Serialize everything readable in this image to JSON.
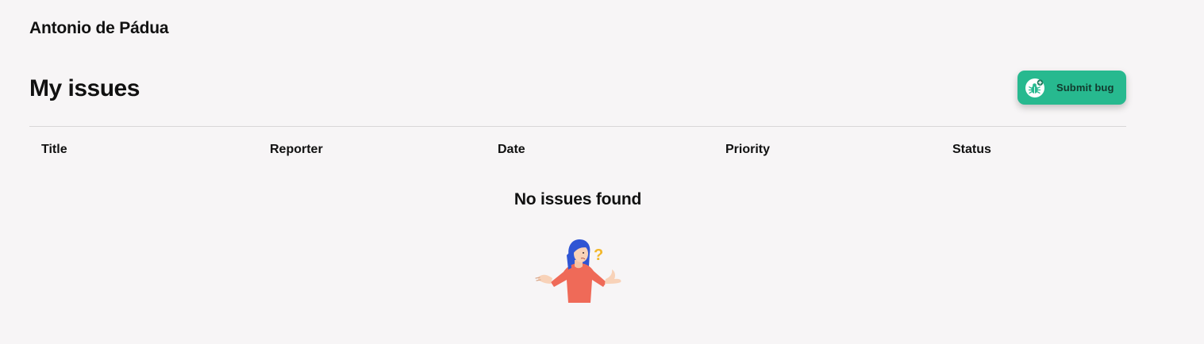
{
  "header": {
    "user_name": "Antonio de Pádua"
  },
  "page": {
    "title": "My issues"
  },
  "toolbar": {
    "submit_label": "Submit bug",
    "submit_icon": "bug-add-icon"
  },
  "table": {
    "columns": [
      "Title",
      "Reporter",
      "Date",
      "Priority",
      "Status"
    ],
    "rows": []
  },
  "empty_state": {
    "message": "No issues found",
    "illustration": "confused-person-illustration",
    "question_mark": "?"
  },
  "colors": {
    "background": "#f7f5f6",
    "accent": "#27b98f",
    "divider": "#d9d6d8",
    "text": "#111111"
  }
}
